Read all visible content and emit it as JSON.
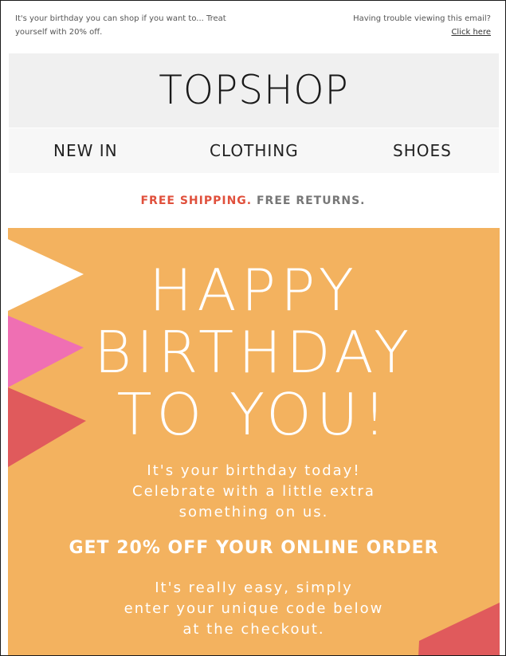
{
  "preheader": {
    "left_line1": "It's your birthday you can shop if you want to... Treat",
    "left_line2": "yourself with 20% off.",
    "right_text": "Having trouble viewing this email?",
    "right_link": "Click here"
  },
  "header": {
    "logo": "TOPSHOP"
  },
  "nav": {
    "items": [
      {
        "label": "NEW IN"
      },
      {
        "label": "CLOTHING"
      },
      {
        "label": "SHOES"
      }
    ]
  },
  "shipping": {
    "free_shipping": "FREE SHIPPING.",
    "free_returns": "FREE RETURNS.",
    "free_shipping_color": "#e0503c"
  },
  "hero": {
    "background_color": "#f3b25f",
    "title_line1": "HAPPY",
    "title_line2": "BIRTHDAY",
    "title_line3": "TO YOU!",
    "message_line1": "It's your birthday today!",
    "message_line2": "Celebrate with a little extra",
    "message_line3": "something on us.",
    "offer": "GET 20% OFF YOUR ONLINE ORDER",
    "instructions_line1": "It's really easy, simply",
    "instructions_line2": "enter your unique code below",
    "instructions_line3": "at the checkout.",
    "bunting_colors": [
      "#ffffff",
      "#ef6fb3",
      "#e05a5c"
    ]
  }
}
